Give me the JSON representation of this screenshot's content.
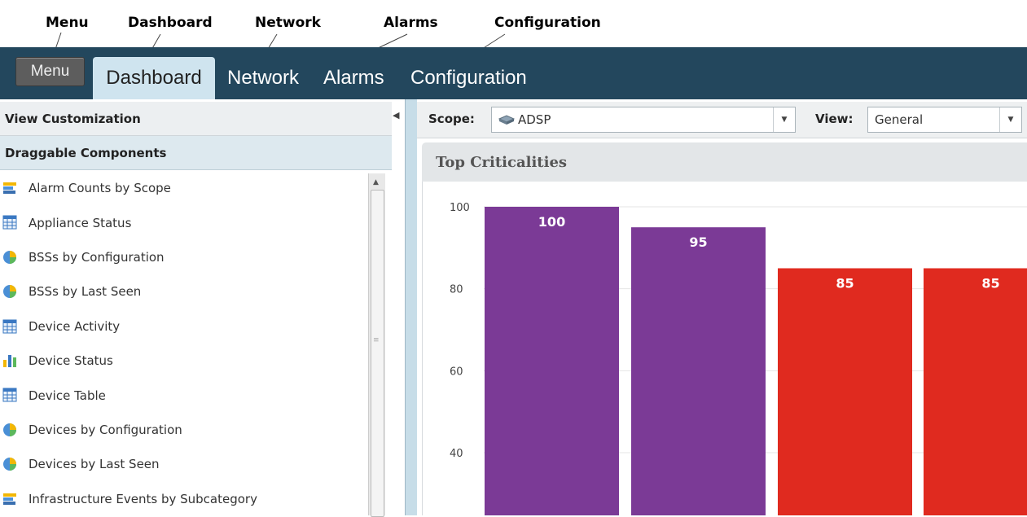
{
  "callouts": {
    "menu": "Menu",
    "dashboard": "Dashboard",
    "network": "Network",
    "alarms": "Alarms",
    "configuration": "Configuration"
  },
  "nav": {
    "menu_label": "Menu",
    "tabs": [
      {
        "label": "Dashboard",
        "active": true
      },
      {
        "label": "Network"
      },
      {
        "label": "Alarms"
      },
      {
        "label": "Configuration"
      }
    ]
  },
  "sidebar": {
    "view_customization": "View Customization",
    "draggable_components": "Draggable Components",
    "items": [
      {
        "label": "Alarm Counts by Scope",
        "icon": "bar-horizontal-icon"
      },
      {
        "label": "Appliance Status",
        "icon": "table-icon"
      },
      {
        "label": "BSSs by Configuration",
        "icon": "pie-icon"
      },
      {
        "label": "BSSs by Last Seen",
        "icon": "pie-icon"
      },
      {
        "label": "Device Activity",
        "icon": "table-icon"
      },
      {
        "label": "Device Status",
        "icon": "bar-vertical-icon"
      },
      {
        "label": "Device Table",
        "icon": "table-icon"
      },
      {
        "label": "Devices by Configuration",
        "icon": "pie-icon"
      },
      {
        "label": "Devices by Last Seen",
        "icon": "pie-icon"
      },
      {
        "label": "Infrastructure Events by Subcategory",
        "icon": "bar-horizontal-icon"
      }
    ]
  },
  "toolbar": {
    "scope_label": "Scope:",
    "scope_value": "ADSP",
    "view_label": "View:",
    "view_value": "General"
  },
  "panel": {
    "title": "Top Criticalities"
  },
  "colors": {
    "nav_bg": "#23475d",
    "purple": "#7b3a96",
    "red": "#e02a1f"
  },
  "chart_data": {
    "type": "bar",
    "title": "Top Criticalities",
    "yticks": [
      100,
      80,
      60,
      40
    ],
    "ylim": [
      30,
      100
    ],
    "values": [
      100,
      95,
      85,
      85
    ],
    "data_labels": [
      "100",
      "95",
      "85",
      "85"
    ],
    "bar_colors": [
      "#7b3a96",
      "#7b3a96",
      "#e02a1f",
      "#e02a1f"
    ],
    "grid": true
  }
}
